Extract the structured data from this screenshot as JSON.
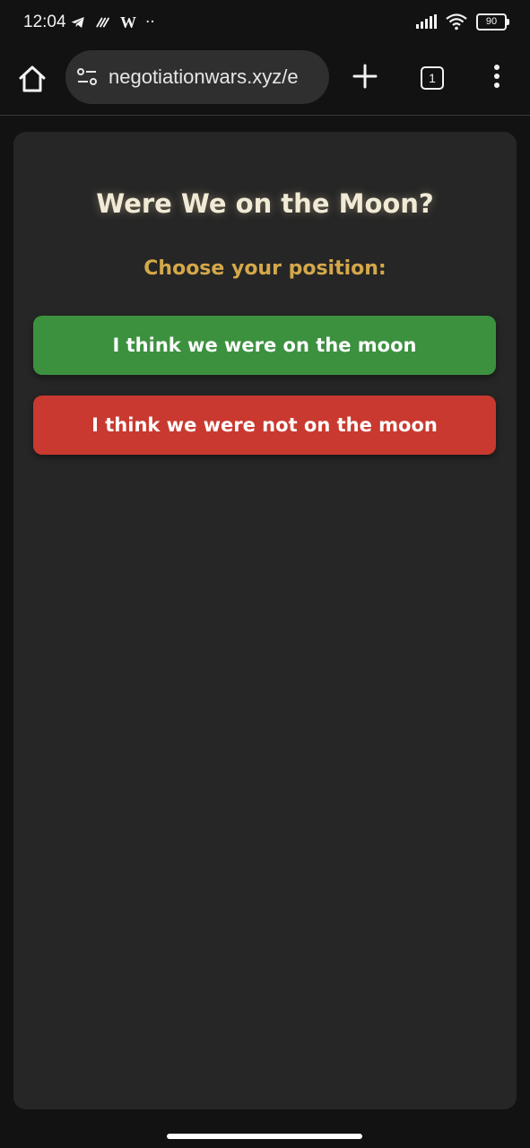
{
  "status_bar": {
    "time": "12:04",
    "w_glyph": "W",
    "dots": "··",
    "battery": "90",
    "icons": [
      "telegram-icon",
      "app-icon",
      "wikipedia-icon",
      "more-notifications-icon",
      "signal-icon",
      "wifi-icon",
      "battery-icon"
    ]
  },
  "browser": {
    "url": "negotiationwars.xyz/e",
    "tab_count": "1",
    "icons": [
      "home-icon",
      "site-settings-icon",
      "new-tab-icon",
      "tabs-icon",
      "menu-icon"
    ]
  },
  "page": {
    "title": "Were We on the Moon?",
    "subtitle": "Choose your position:",
    "option_yes": "I think we were on the moon",
    "option_no": "I think we were not on the moon"
  },
  "colors": {
    "background": "#121212",
    "card": "#262626",
    "title": "#f1ead6",
    "subtitle": "#d4a84a",
    "yes_button": "#3c913f",
    "no_button": "#c9392f"
  }
}
